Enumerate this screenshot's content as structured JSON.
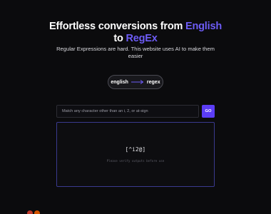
{
  "hero": {
    "title_prefix": "Effortless conversions from ",
    "title_source": "English",
    "title_middle": "to ",
    "title_target": "RegEx",
    "subtitle": "Regular Expressions are hard. This website uses AI to make them easier"
  },
  "mode_toggle": {
    "from_label": "english",
    "to_label": "regex",
    "arrow_icon": "long-arrow-right-icon"
  },
  "query": {
    "placeholder": "Match any character other than an i, 2, or at-sign",
    "value": "",
    "go_label": "GO"
  },
  "output": {
    "regex": "[^i2@]",
    "note": "Please verify outputs before use"
  },
  "colors": {
    "accent": "#6d5cf6",
    "button": "#5b3df5",
    "panel_border": "#3a3a8f",
    "background": "#0b0b0d"
  }
}
